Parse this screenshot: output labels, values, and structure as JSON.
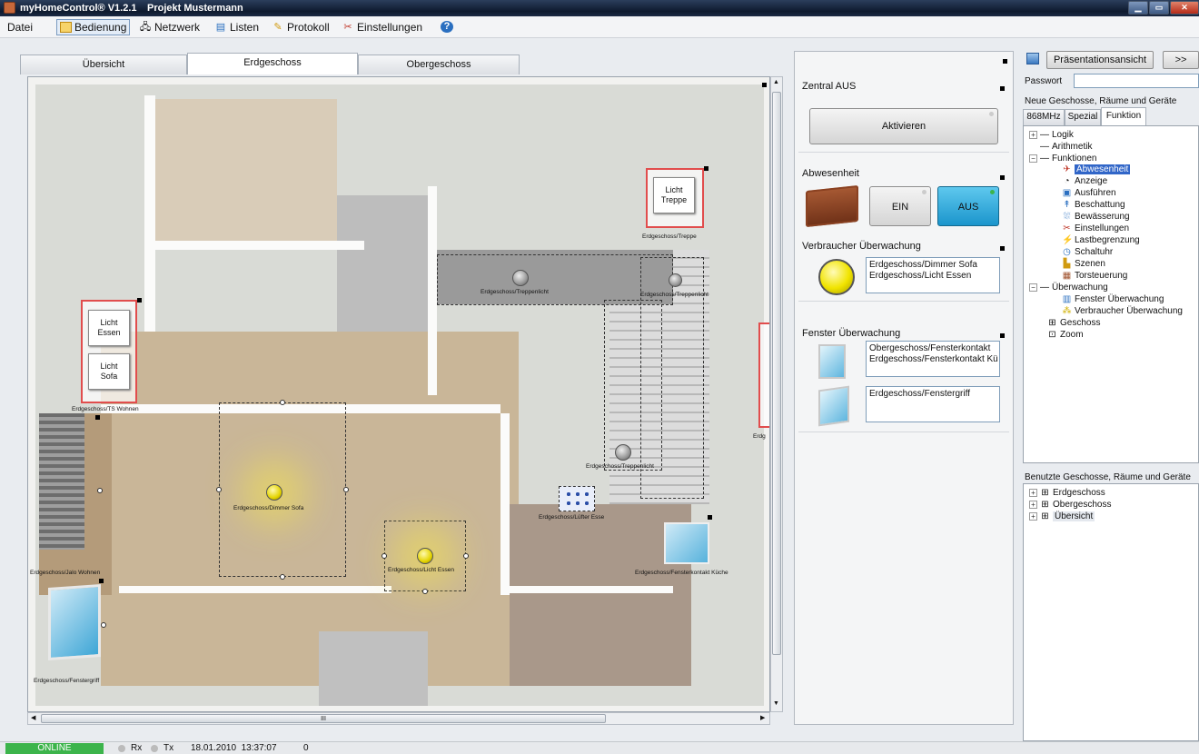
{
  "window": {
    "app_title": "myHomeControl® V1.2.1",
    "project": "Projekt Mustermann"
  },
  "menu": {
    "datei": "Datei",
    "bedienung": "Bedienung",
    "netzwerk": "Netzwerk",
    "listen": "Listen",
    "protokoll": "Protokoll",
    "einstellungen": "Einstellungen"
  },
  "tabs": [
    "Übersicht",
    "Erdgeschoss",
    "Obergeschoss"
  ],
  "floorplan": {
    "switch_essen": "Licht\nEssen",
    "switch_sofa": "Licht\nSofa",
    "switch_treppe": "Licht\nTreppe",
    "labels": {
      "ts_wohnen": "Erdgeschoss/TS Wohnen",
      "treppe": "Erdgeschoss/Treppe",
      "treppenlicht_1": "Erdgeschoss/Treppenlicht",
      "treppenlicht_2": "Erdgeschoss/Treppenlicht",
      "treppenlicht_3": "Erdgeschoss/Treppenlicht",
      "dimmer_sofa": "Erdgeschoss/Dimmer Sofa",
      "licht_essen": "Erdgeschoss/Licht Essen",
      "luefter": "Erdgeschoss/Lüfter Esse",
      "jalo": "Erdgeschoss/Jalo Wohnen",
      "fensterkontakt_kueche": "Erdgeschoss/Fensterkontakt Küche",
      "fenstergriff": "Erdgeschoss/Fenstergriff",
      "erdg_cut": "Erdg"
    },
    "scroll_h_mark": "III"
  },
  "middle": {
    "zentral_title": "Zentral AUS",
    "zentral_button": "Aktivieren",
    "abwesenheit_title": "Abwesenheit",
    "ein": "EIN",
    "aus": "AUS",
    "verbraucher_title": "Verbraucher Überwachung",
    "verbraucher_lines": [
      "Erdgeschoss/Dimmer Sofa",
      "Erdgeschoss/Licht Essen"
    ],
    "fenster_title": "Fenster Überwachung",
    "fenster_lines_1": [
      "Obergeschoss/Fensterkontakt",
      "Erdgeschoss/Fensterkontakt Kü"
    ],
    "fenster_lines_2": [
      "Erdgeschoss/Fenstergriff"
    ]
  },
  "right": {
    "praesentation": "Präsentationsansicht",
    "next": ">>",
    "passwort": "Passwort",
    "neue_title": "Neue Geschosse, Räume und Geräte",
    "subtabs": [
      "868MHz",
      "Spezial",
      "Funktion"
    ],
    "tree": {
      "logik": "Logik",
      "arithmetik": "Arithmetik",
      "funktionen": "Funktionen",
      "items": [
        "Abwesenheit",
        "Anzeige",
        "Ausführen",
        "Beschattung",
        "Bewässerung",
        "Einstellungen",
        "Lastbegrenzung",
        "Schaltuhr",
        "Szenen",
        "Torsteuerung"
      ],
      "ueberwachung": "Überwachung",
      "ueberwachung_items": [
        "Fenster Überwachung",
        "Verbraucher Überwachung"
      ],
      "geschoss": "Geschoss",
      "zoom": "Zoom"
    },
    "benutzte_title": "Benutzte Geschosse, Räume und Geräte",
    "used": [
      "Erdgeschoss",
      "Obergeschoss",
      "Übersicht"
    ]
  },
  "status": {
    "online": "ONLINE",
    "rx": "Rx",
    "tx": "Tx",
    "datetime": "18.01.2010  13:37:07",
    "count": "0"
  },
  "colors": {
    "online_green": "#3cb44b",
    "aus_blue": "#25a6d9",
    "switch_border": "#e14d4d"
  }
}
